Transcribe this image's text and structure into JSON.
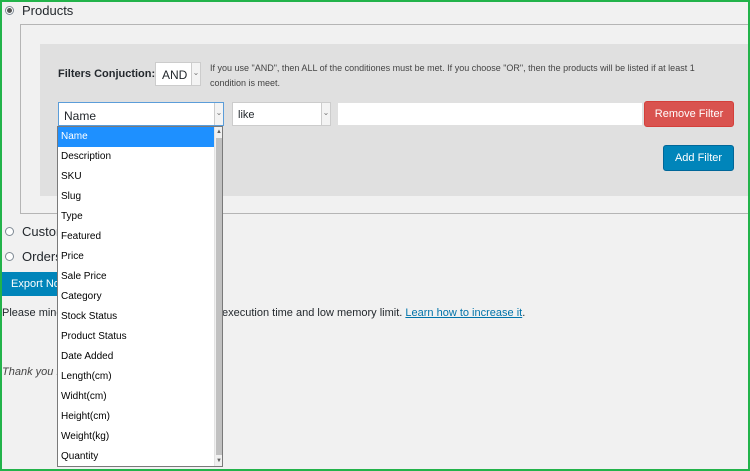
{
  "sections": {
    "products_label": "Products",
    "customers_label": "Custom",
    "orders_label": "Orders"
  },
  "filters": {
    "conjunction_label": "Filters Conjuction:",
    "conjunction_value": "AND",
    "conjunction_info": "If you use \"AND\", then ALL of the conditiones must be met. If you choose \"OR\", then the products will be listed if at least 1 condition is meet.",
    "field_value": "Name",
    "operator_value": "like",
    "text_value": "",
    "remove_button": "Remove Filter",
    "add_button": "Add Filter"
  },
  "field_options": [
    "Name",
    "Description",
    "SKU",
    "Slug",
    "Type",
    "Featured",
    "Price",
    "Sale Price",
    "Category",
    "Stock Status",
    "Product Status",
    "Date Added",
    "Length(cm)",
    "Widht(cm)",
    "Height(cm)",
    "Weight(kg)",
    "Quantity"
  ],
  "export_button": "Export No",
  "notice": {
    "prefix": "Please mind",
    "suffix": "execution time and low memory limit.",
    "link": "Learn how to increase it",
    "end": "."
  },
  "thanks": "Thank you f",
  "colors": {
    "primary": "#0085ba",
    "danger": "#d9534f",
    "selection": "#1e90ff",
    "frame": "#22b34a"
  }
}
